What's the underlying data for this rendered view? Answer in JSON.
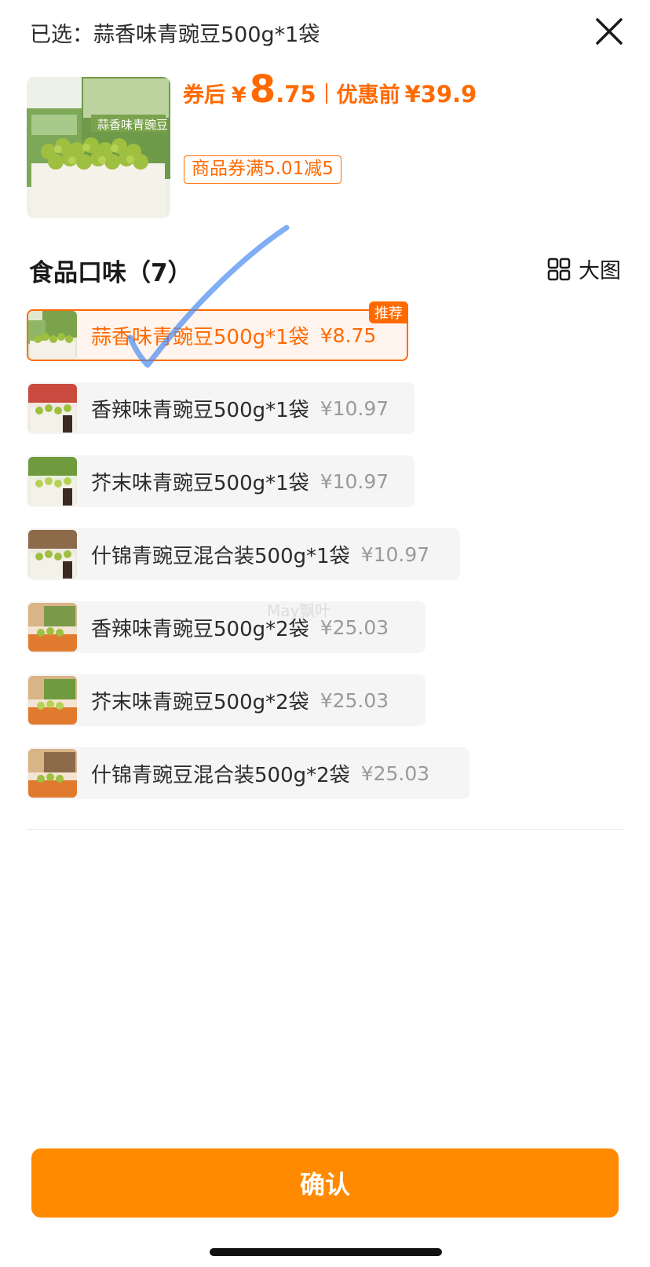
{
  "header": {
    "selected_text": "已选：蒜香味青豌豆500g*1袋",
    "close_icon": "close-icon"
  },
  "product": {
    "image_icon": "garlic-peas-package",
    "after_coupon_label": "券后",
    "currency": "¥",
    "price_int": "8",
    "price_dec": ".75",
    "before_label": "优惠前",
    "before_price": "¥39.9",
    "coupon": "商品券满5.01减5"
  },
  "section": {
    "title": "食品口味（7）",
    "toggle_label": "大图",
    "toggle_icon": "grid-icon"
  },
  "options": [
    {
      "name": "蒜香味青豌豆500g*1袋",
      "price": "¥8.75",
      "badge": "推荐",
      "selected": true
    },
    {
      "name": "香辣味青豌豆500g*1袋",
      "price": "¥10.97"
    },
    {
      "name": "芥末味青豌豆500g*1袋",
      "price": "¥10.97"
    },
    {
      "name": "什锦青豌豆混合装500g*1袋",
      "price": "¥10.97"
    },
    {
      "name": "香辣味青豌豆500g*2袋",
      "price": "¥25.03"
    },
    {
      "name": "芥末味青豌豆500g*2袋",
      "price": "¥25.03"
    },
    {
      "name": "什锦青豌豆混合装500g*2袋",
      "price": "¥25.03"
    }
  ],
  "watermark": "May飘叶",
  "confirm_label": "确认",
  "colors": {
    "accent": "#ff6a00",
    "button": "#ff8a00",
    "check_stroke": "#4a8cf0"
  }
}
